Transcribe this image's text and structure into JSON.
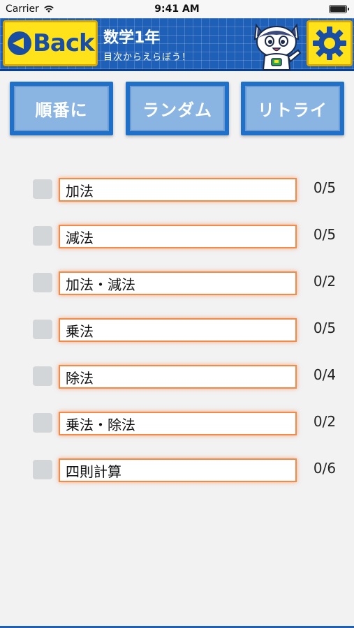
{
  "status_bar": {
    "carrier": "Carrier",
    "time": "9:41 AM"
  },
  "header": {
    "back_label": "Back",
    "title": "数学1年",
    "subtitle": "目次からえらぼう！"
  },
  "modes": [
    {
      "label": "順番に"
    },
    {
      "label": "ランダム"
    },
    {
      "label": "リトライ"
    }
  ],
  "items": [
    {
      "name": "加法",
      "score": "0/5"
    },
    {
      "name": "減法",
      "score": "0/5"
    },
    {
      "name": "加法・減法",
      "score": "0/2"
    },
    {
      "name": "乗法",
      "score": "0/5"
    },
    {
      "name": "除法",
      "score": "0/4"
    },
    {
      "name": "乗法・除法",
      "score": "0/2"
    },
    {
      "name": "四則計算",
      "score": "0/6"
    }
  ],
  "colors": {
    "header_blue": "#1e5fb8",
    "button_yellow": "#ffe21a",
    "mode_blue": "#1f70c8",
    "accent_orange": "#f28a4a"
  }
}
